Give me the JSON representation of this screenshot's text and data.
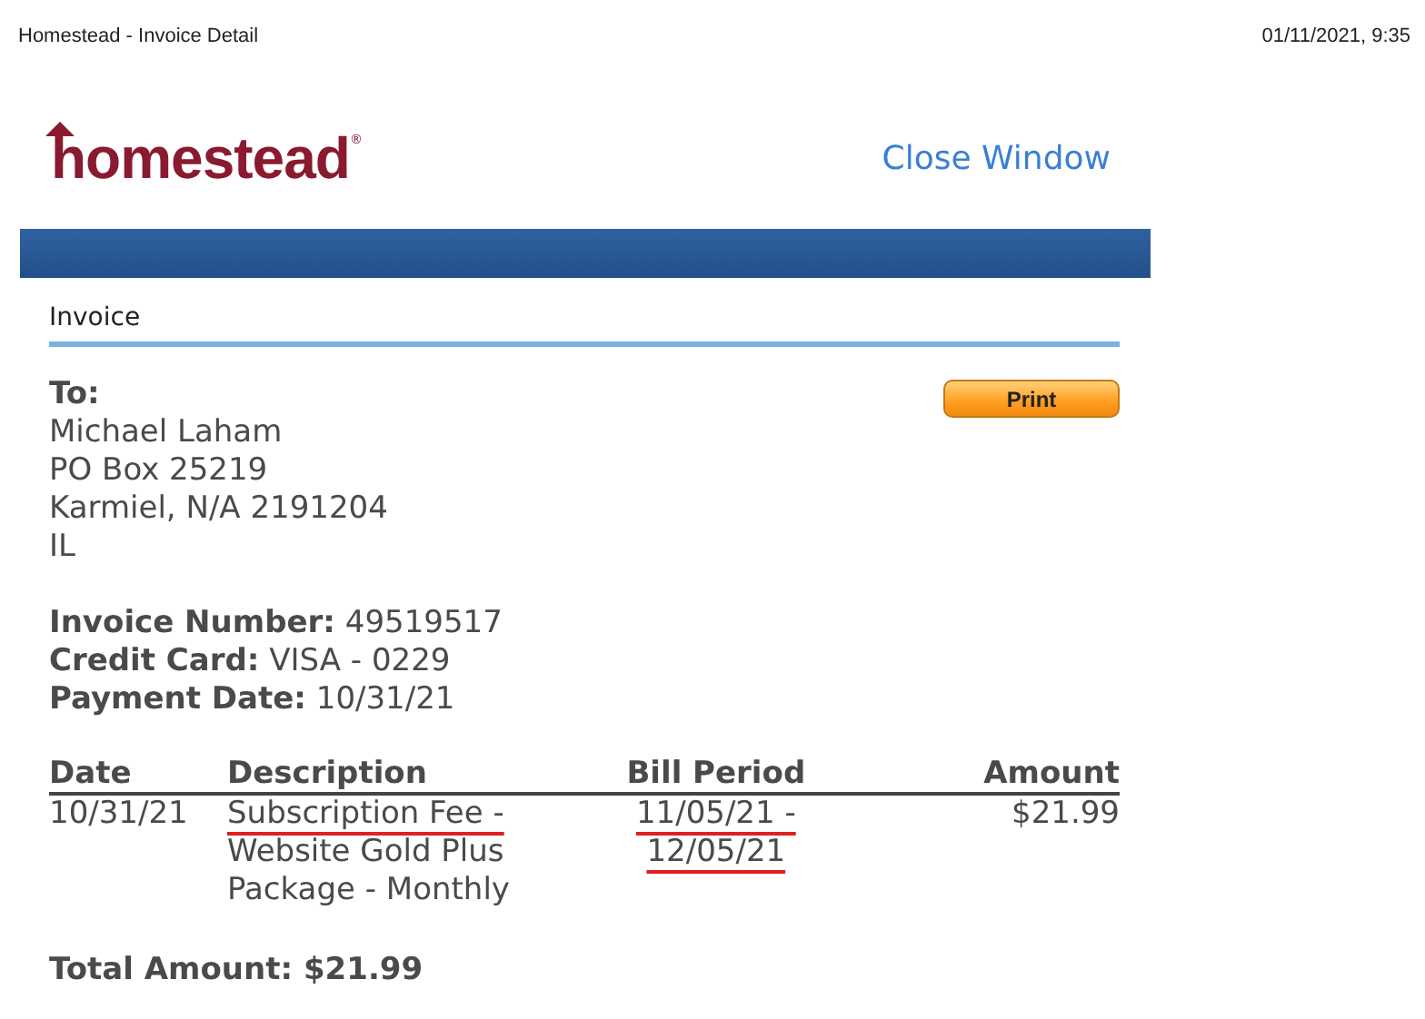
{
  "print_header": {
    "title": "Homestead - Invoice Detail",
    "timestamp": "01/11/2021, 9:35"
  },
  "logo": {
    "text": "homestead",
    "mark": "®"
  },
  "close_link": "Close Window",
  "section_title": "Invoice",
  "print_button": "Print",
  "recipient": {
    "label": "To:",
    "lines": [
      "Michael Laham",
      "PO Box 25219",
      "Karmiel, N/A 2191204",
      "IL"
    ]
  },
  "details": [
    {
      "label": "Invoice Number:",
      "value": "49519517"
    },
    {
      "label": "Credit Card:",
      "value": "VISA - 0229"
    },
    {
      "label": "Payment Date:",
      "value": "10/31/21"
    }
  ],
  "table": {
    "columns": [
      "Date",
      "Description",
      "Bill Period",
      "Amount"
    ],
    "rows": [
      {
        "date": "10/31/21",
        "description": "Subscription Fee - Website Gold Plus Package - Monthly",
        "description_underlined": true,
        "bill_period": "11/05/21 - 12/05/21",
        "bill_period_underlined": true,
        "amount": "$21.99"
      }
    ]
  },
  "total": "Total Amount: $21.99"
}
